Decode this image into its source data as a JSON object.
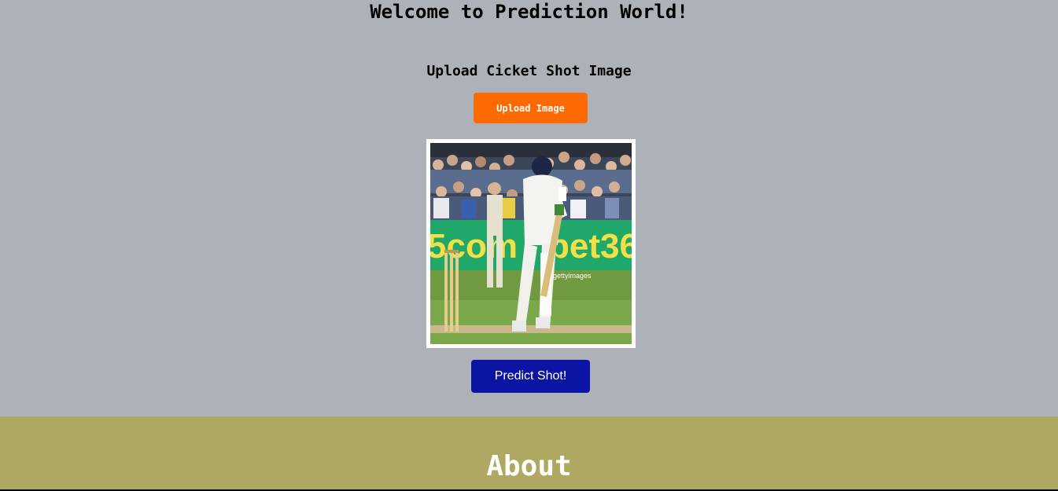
{
  "header": {
    "title": "Welcome to Prediction World!"
  },
  "upload": {
    "heading": "Upload Cicket Shot Image",
    "button_label": "Upload Image"
  },
  "preview": {
    "image_subject": "cricket batsman playing a defensive shot",
    "watermark": "gettyimages"
  },
  "predict": {
    "button_label": "Predict Shot!"
  },
  "about": {
    "title": "About"
  },
  "colors": {
    "page_background": "#adb1b8",
    "upload_button": "#ff6a00",
    "predict_button": "#0b14a3",
    "about_background": "#afa862"
  }
}
